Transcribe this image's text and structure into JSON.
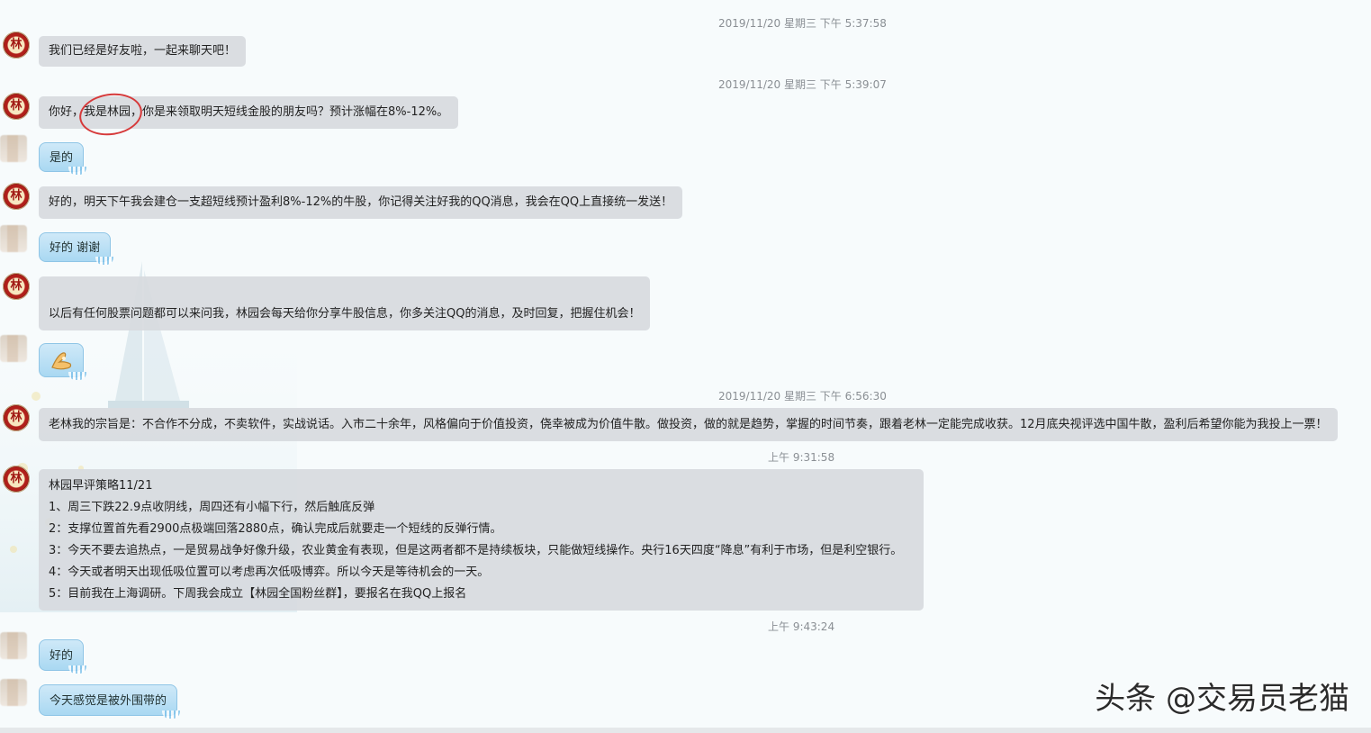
{
  "watermark": "头条 @交易员老猫",
  "avatar_glyph": "林",
  "messages": [
    {
      "timestamp": "2019/11/20 星期三 下午 5:37:58"
    },
    {
      "text": "我们已经是好友啦，一起来聊天吧！"
    },
    {
      "timestamp": "2019/11/20 星期三 下午 5:39:07"
    },
    {
      "text": "你好，我是林园，你是来领取明天短线金股的朋友吗？预计涨幅在8%-12%。"
    },
    {
      "text": "是的"
    },
    {
      "text": "好的，明天下午我会建仓一支超短线预计盈利8%-12%的牛股，你记得关注好我的QQ消息，我会在QQ上直接统一发送！"
    },
    {
      "text": "好的 谢谢"
    },
    {
      "text": "以后有任何股票问题都可以来问我，林园会每天给你分享牛股信息，你多关注QQ的消息，及时回复，把握住机会！"
    },
    {
      "emoji": "ok-hand-emoji"
    },
    {
      "timestamp": "2019/11/20 星期三 下午 6:56:30"
    },
    {
      "text": "老林我的宗旨是：不合作不分成，不卖软件，实战说话。入市二十余年，风格偏向于价值投资，侥幸被成为价值牛散。做投资，做的就是趋势，掌握的时间节奏，跟着老林一定能完成收获。12月底央视评选中国牛散，盈利后希望你能为我投上一票！"
    },
    {
      "timestamp": "上午 9:31:58"
    },
    {
      "lines": [
        "林园早评策略11/21",
        "1、周三下跌22.9点收阴线，周四还有小幅下行，然后触底反弹",
        "2：支撑位置首先看2900点极端回落2880点，确认完成后就要走一个短线的反弹行情。",
        "3：今天不要去追热点，一是贸易战争好像升级，农业黄金有表现，但是这两者都不是持续板块，只能做短线操作。央行16天四度“降息”有利于市场，但是利空银行。",
        "4：今天或者明天出现低吸位置可以考虑再次低吸博弈。所以今天是等待机会的一天。",
        "5：目前我在上海调研。下周我会成立【林园全国粉丝群】，要报名在我QQ上报名"
      ]
    },
    {
      "timestamp": "上午 9:43:24"
    },
    {
      "text": "好的"
    },
    {
      "text": "今天感觉是被外围带的"
    }
  ]
}
